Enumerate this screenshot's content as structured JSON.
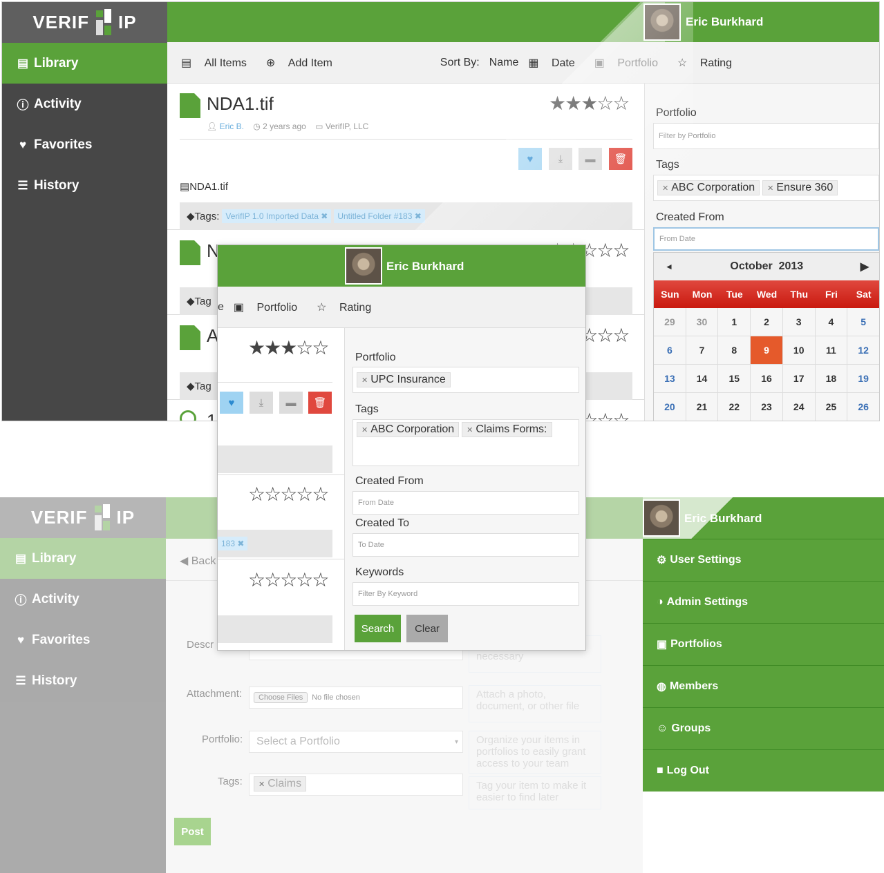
{
  "brand": {
    "logo_left": "VERIF",
    "logo_right": "IP"
  },
  "user": {
    "name": "Eric Burkhard"
  },
  "nav": [
    {
      "icon": "book-icon",
      "glyph": "▤",
      "label": "Library"
    },
    {
      "icon": "exclamation-icon",
      "glyph": "ⓘ",
      "label": "Activity"
    },
    {
      "icon": "heart-icon",
      "glyph": "♥",
      "label": "Favorites"
    },
    {
      "icon": "list-icon",
      "glyph": "☰",
      "label": "History"
    }
  ],
  "toolbar": {
    "all_items": "All Items",
    "add_item": "Add Item",
    "sort_by": "Sort By:",
    "sort": [
      "Name",
      "Date",
      "Portfolio",
      "Rating"
    ]
  },
  "items": [
    {
      "title": "NDA1.tif",
      "author": "Eric B.",
      "time": "2 years ago",
      "portfolio": "VerifIP, LLC",
      "file": "NDA1.tif",
      "tags_label": "Tags:",
      "tags": [
        "VerifIP 1.0 Imported Data",
        "Untitled Folder #183"
      ],
      "rating": 3
    },
    {
      "title": "N",
      "rating": 0,
      "tags_label": "Tag"
    },
    {
      "title": "A",
      "rating": 0,
      "tags_label": "Tag"
    },
    {
      "title": "1",
      "rating": 0
    }
  ],
  "filter": {
    "portfolio_label": "Portfolio",
    "portfolio_placeholder": "Filter by Portfolio",
    "tags_label": "Tags",
    "tags": [
      "ABC Corporation",
      "Ensure 360"
    ],
    "created_from_label": "Created From",
    "from_placeholder": "From Date"
  },
  "calendar": {
    "month": "October",
    "year": "2013",
    "prev": "◄",
    "next": "▶",
    "days": [
      "Sun",
      "Mon",
      "Tue",
      "Wed",
      "Thu",
      "Fri",
      "Sat"
    ],
    "dates": [
      "29",
      "30",
      "1",
      "2",
      "3",
      "4",
      "5",
      "6",
      "7",
      "8",
      "9",
      "10",
      "11",
      "12",
      "13",
      "14",
      "15",
      "16",
      "17",
      "18",
      "19",
      "20",
      "21",
      "22",
      "23",
      "24",
      "25",
      "26"
    ],
    "selected": "9",
    "accent": "#d91e18"
  },
  "mobile": {
    "sort": [
      "e",
      "Portfolio",
      "Rating"
    ],
    "portfolio_label": "Portfolio",
    "portfolio_token": "UPC Insurance",
    "tags_label": "Tags",
    "tags": [
      "ABC Corporation",
      "Claims Forms:"
    ],
    "created_from_label": "Created From",
    "from_placeholder": "From Date",
    "created_to_label": "Created To",
    "to_placeholder": "To Date",
    "keywords_label": "Keywords",
    "keywords_placeholder": "Filter By Keyword",
    "search": "Search",
    "clear": "Clear",
    "chip": "183"
  },
  "add_form": {
    "back": "Back",
    "desc_label": "Descr",
    "desc_hint": "Add more information if necessary",
    "attach_label": "Attachment:",
    "choose_files": "Choose Files",
    "no_file": "No file chosen",
    "attach_hint": "Attach a photo, document, or other file",
    "portfolio_label": "Portfolio:",
    "portfolio_select": "Select a Portfolio",
    "portfolio_hint": "Organize your items in portfolios to easily grant access to your team",
    "tags_label": "Tags:",
    "tag": "Claims",
    "tags_hint": "Tag your item to make it easier to find later",
    "post": "Post"
  },
  "user_menu": [
    {
      "icon": "gear-icon",
      "glyph": "⚙",
      "label": "User Settings"
    },
    {
      "icon": "half-circle-icon",
      "glyph": "◑",
      "label": "Admin Settings"
    },
    {
      "icon": "briefcase-icon",
      "glyph": "▣",
      "label": "Portfolios"
    },
    {
      "icon": "globe-icon",
      "glyph": "◍",
      "label": "Members"
    },
    {
      "icon": "users-icon",
      "glyph": "☺",
      "label": "Groups"
    },
    {
      "icon": "lock-icon",
      "glyph": "■",
      "label": "Log Out"
    }
  ],
  "colors": {
    "green": "#5aa23a",
    "dark": "#474747",
    "red": "#d91e18",
    "blue": "#9fd3f2"
  }
}
